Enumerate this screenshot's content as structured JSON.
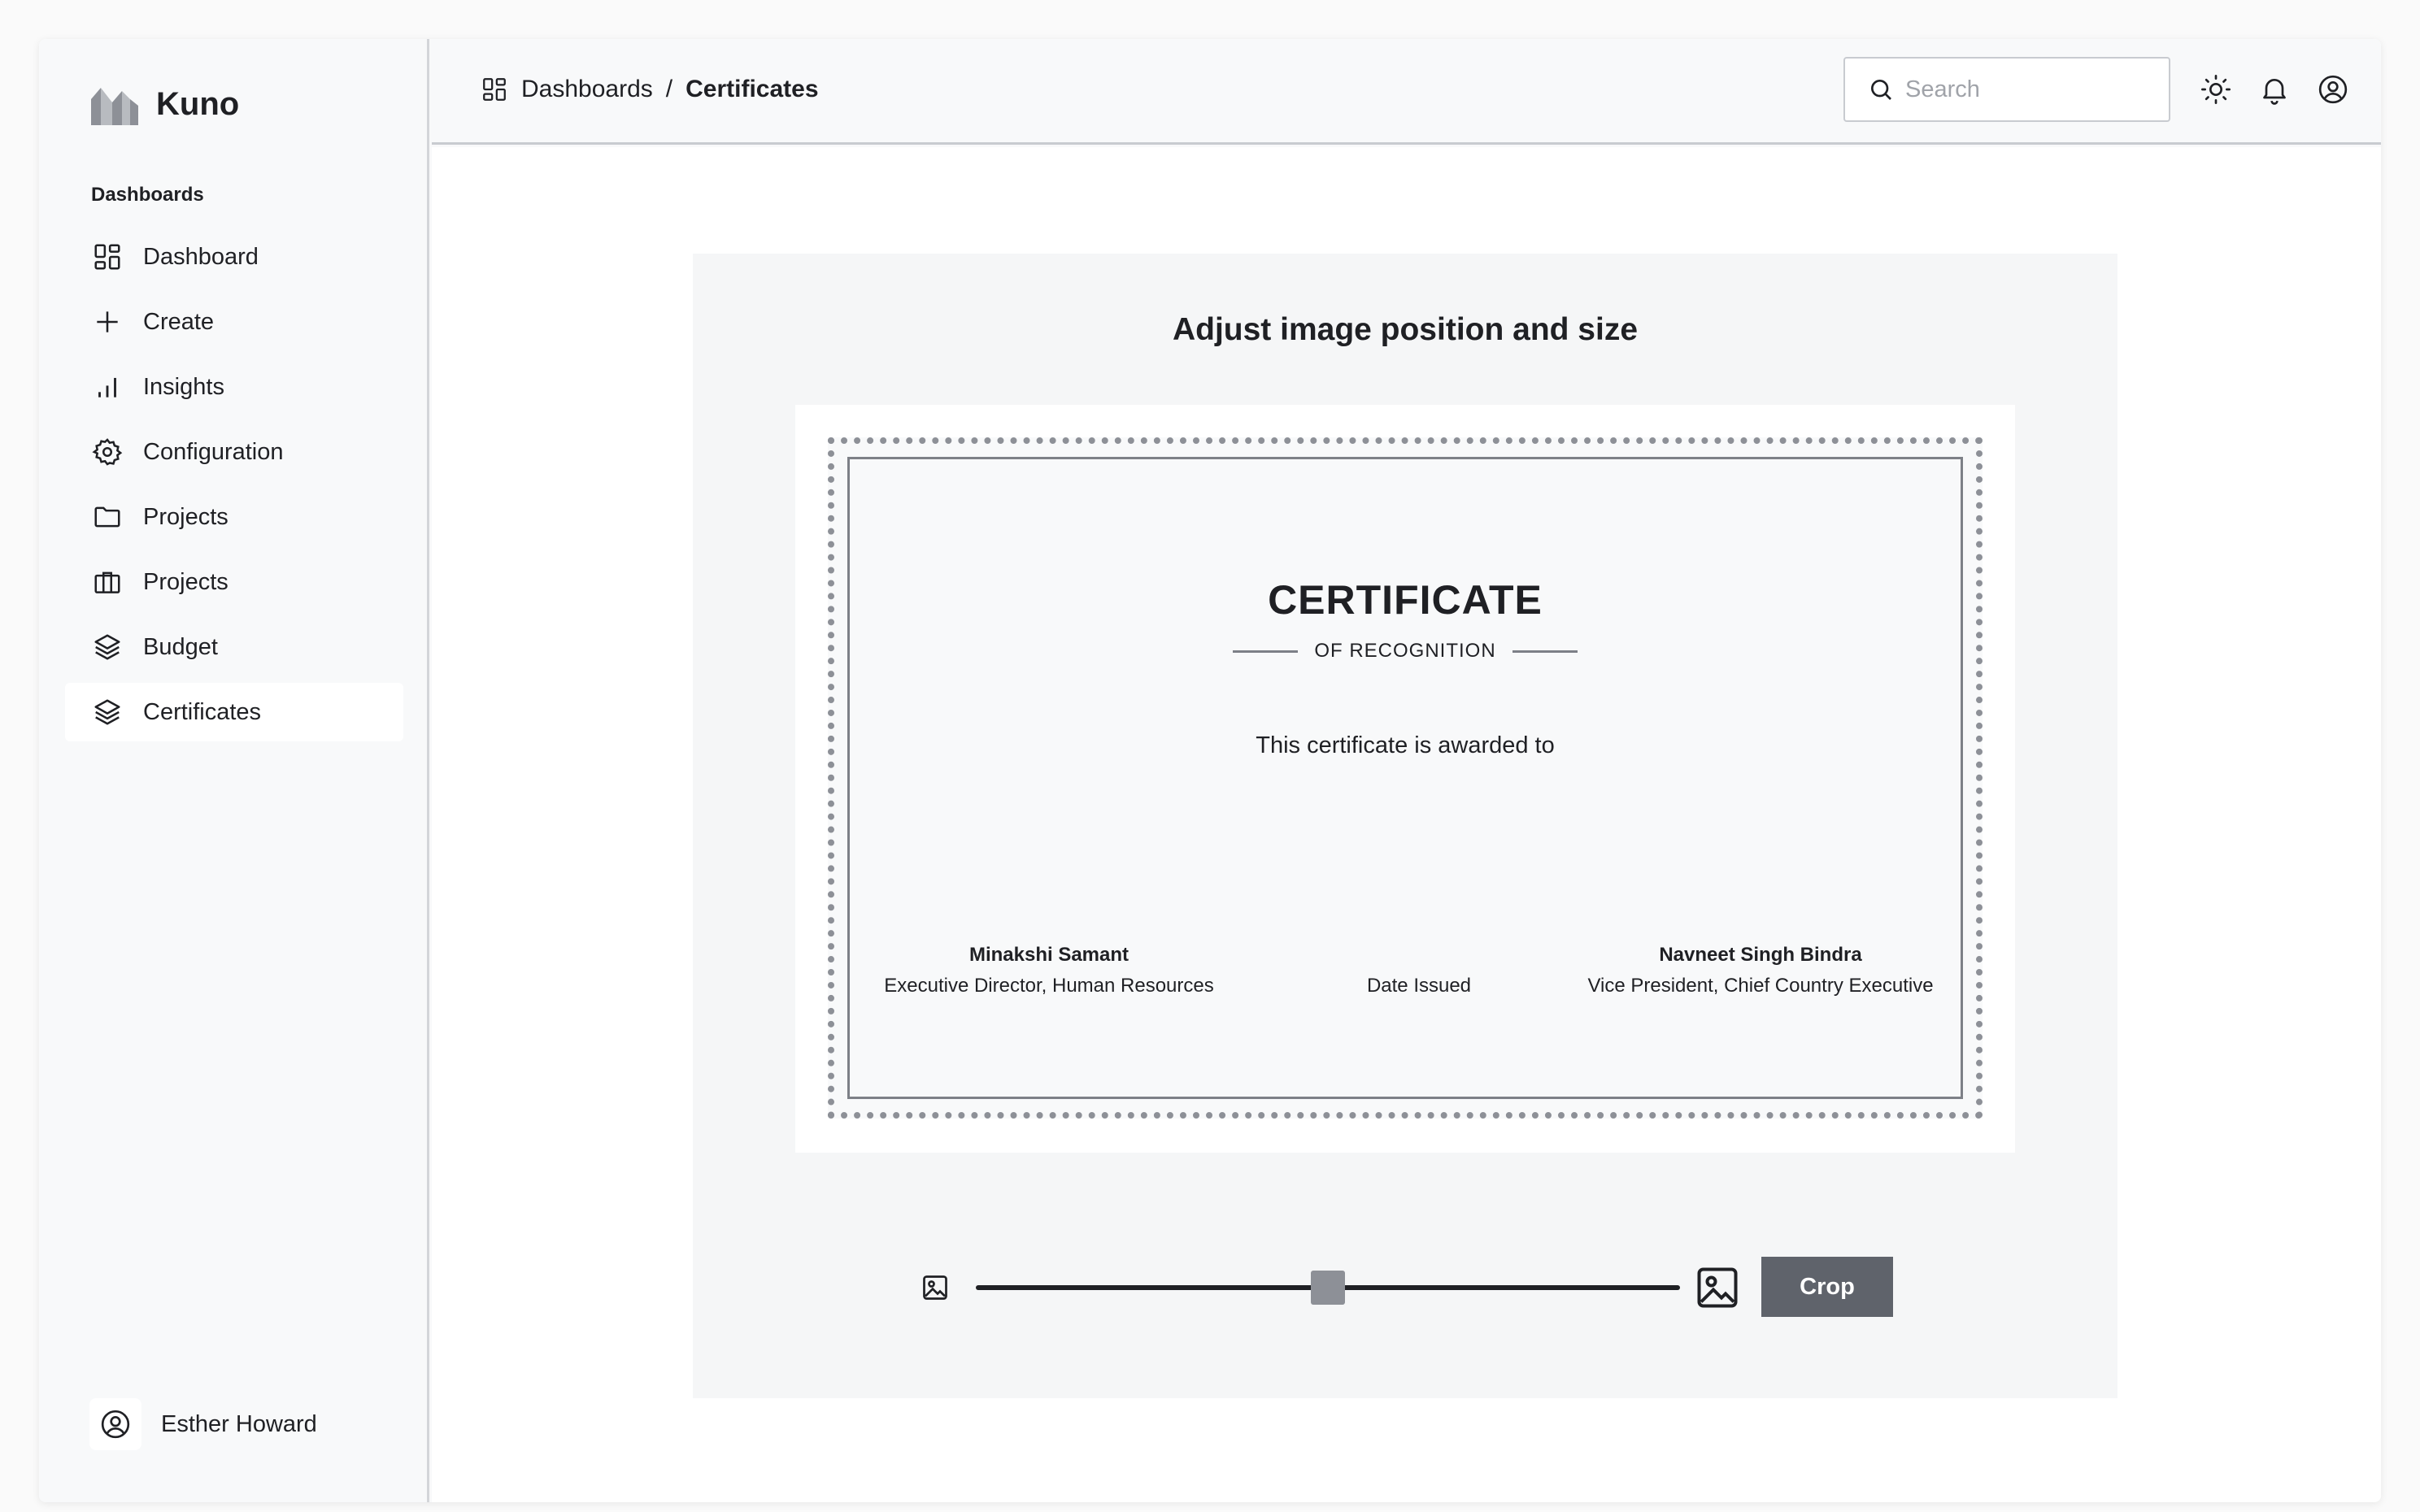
{
  "brand": {
    "name": "Kuno"
  },
  "sidebar": {
    "section_label": "Dashboards",
    "items": [
      {
        "label": "Dashboard",
        "icon": "grid-icon",
        "active": false
      },
      {
        "label": "Create",
        "icon": "plus-icon",
        "active": false
      },
      {
        "label": "Insights",
        "icon": "bar-chart-icon",
        "active": false
      },
      {
        "label": "Configuration",
        "icon": "gear-icon",
        "active": false
      },
      {
        "label": "Projects",
        "icon": "folder-icon",
        "active": false
      },
      {
        "label": "Projects",
        "icon": "briefcase-icon",
        "active": false
      },
      {
        "label": "Budget",
        "icon": "layers-icon",
        "active": false
      },
      {
        "label": "Certificates",
        "icon": "layers-icon",
        "active": true
      }
    ],
    "user": {
      "name": "Esther Howard"
    }
  },
  "header": {
    "breadcrumb": [
      "Dashboards",
      "Certificates"
    ],
    "breadcrumb_separator": "/",
    "search_placeholder": "Search"
  },
  "editor": {
    "title": "Adjust image position and size",
    "zoom_value": 0.5,
    "crop_label": "Crop"
  },
  "certificate": {
    "title": "CERTIFICATE",
    "subtitle": "OF RECOGNITION",
    "awarded_text": "This certificate is awarded to",
    "signatories": [
      {
        "name": "Minakshi Samant",
        "role": "Executive Director, Human Resources"
      },
      {
        "name": "",
        "role": "Date Issued"
      },
      {
        "name": "Navneet Singh Bindra",
        "role": "Vice President, Chief Country Executive"
      }
    ]
  },
  "colors": {
    "active_nav_bg": "#ffffff",
    "button_bg": "#5f636b",
    "slider_thumb": "#8d9097",
    "text": "#1f2024"
  }
}
